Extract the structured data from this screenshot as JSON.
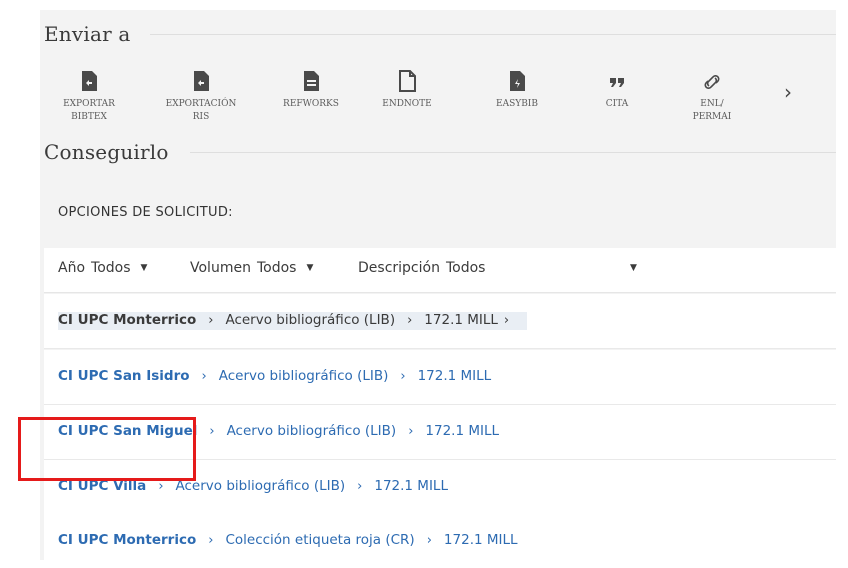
{
  "send_to": {
    "title": "Enviar a",
    "actions": [
      {
        "icon": "export-bibtex-icon",
        "label_line1": "EXPORTAR",
        "label_line2": "BIBTEX"
      },
      {
        "icon": "export-ris-icon",
        "label_line1": "EXPORTACIÓN",
        "label_line2": "RIS"
      },
      {
        "icon": "refworks-icon",
        "label_line1": "REFWORKS",
        "label_line2": ""
      },
      {
        "icon": "endnote-icon",
        "label_line1": "ENDNOTE",
        "label_line2": ""
      },
      {
        "icon": "easybib-icon",
        "label_line1": "EASYBIB",
        "label_line2": ""
      },
      {
        "icon": "quote-icon",
        "label_line1": "CITA",
        "label_line2": ""
      },
      {
        "icon": "link-icon",
        "label_line1": "ENL/",
        "label_line2": "PERMAI"
      }
    ],
    "next_icon": "chevron-right-icon"
  },
  "get_it": {
    "title": "Conseguirlo",
    "options_label": "OPCIONES DE SOLICITUD:",
    "filters": {
      "year": {
        "label": "Año",
        "value": "Todos"
      },
      "volume": {
        "label": "Volumen",
        "value": "Todos"
      },
      "description": {
        "label": "Descripción",
        "value": "Todos"
      }
    },
    "locations": [
      {
        "library": "CI UPC Monterrico",
        "collection": "Acervo bibliográfico (LIB)",
        "call_number": "172.1 MILL",
        "trailing": "›"
      },
      {
        "library": "CI UPC San Isidro",
        "collection": "Acervo bibliográfico (LIB)",
        "call_number": "172.1 MILL",
        "trailing": ""
      },
      {
        "library": "CI UPC San Miguel",
        "collection": "Acervo bibliográfico (LIB)",
        "call_number": "172.1 MILL",
        "trailing": ""
      },
      {
        "library": "CI UPC Villa",
        "collection": "Acervo bibliográfico (LIB)",
        "call_number": "172.1 MILL",
        "trailing": ""
      },
      {
        "library": "CI UPC Monterrico",
        "collection": "Colección etiqueta roja (CR)",
        "call_number": "172.1 MILL",
        "trailing": ""
      }
    ]
  },
  "colors": {
    "link": "#2d6bb2",
    "highlight": "#e51a1a",
    "panel": "#f3f3f3"
  }
}
